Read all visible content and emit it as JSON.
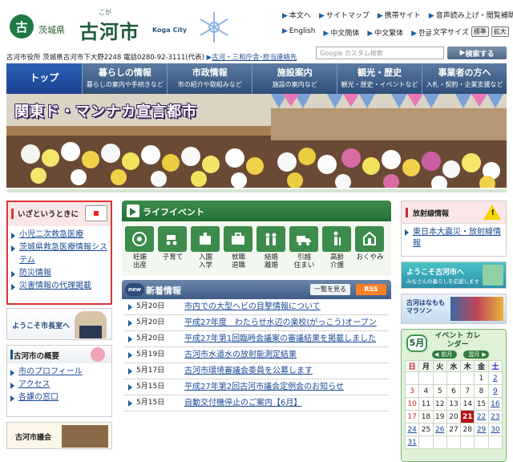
{
  "header": {
    "emblem": "古",
    "prefecture": "茨城県",
    "city_name": "古河市",
    "city_ruby": "こが",
    "city_en": "Koga City",
    "toplinks": [
      "本文へ",
      "サイトマップ",
      "携帯サイト",
      "音声読み上げ・閲覧補助"
    ],
    "languages": [
      "English",
      "中文簡体",
      "中文繁体",
      "한글"
    ],
    "fontsize_label": "文字サイズ",
    "fontsize_standard": "標準",
    "fontsize_large": "拡大",
    "address": "古河市役所 茨城県古河市下大野2248 電話0280-92-3111(代表)",
    "address_link": "古河・三和庁舎･担当連絡先",
    "search_placeholder": "Google カスタム検索",
    "search_button": "検索する"
  },
  "nav": [
    {
      "title": "トップ",
      "sub": ""
    },
    {
      "title": "暮らしの情報",
      "sub": "暮らしの案内や手続きなど"
    },
    {
      "title": "市政情報",
      "sub": "市の紹介や取組みなど"
    },
    {
      "title": "施設案内",
      "sub": "施設の案内など"
    },
    {
      "title": "観光・歴史",
      "sub": "観光・歴史・イベントなど"
    },
    {
      "title": "事業者の方へ",
      "sub": "入札・契約・企業支援など"
    }
  ],
  "banner": {
    "title": "関東ド・マンナカ宣言都市"
  },
  "emergency": {
    "title": "いざというときに",
    "links": [
      "小児二次救急医療",
      "茨城県救急医療情報システム",
      "防災情報",
      "災害情報の代理掲載"
    ]
  },
  "mayor": {
    "title": "ようこそ市長室へ"
  },
  "overview": {
    "title": "古河市の概要",
    "links": [
      "市のプロフィール",
      "アクセス",
      "各課の窓口"
    ]
  },
  "council": {
    "title": "古河市議会"
  },
  "life_event": {
    "title": "ライフイベント",
    "items": [
      {
        "label1": "妊娠",
        "label2": "出産"
      },
      {
        "label1": "子育て",
        "label2": ""
      },
      {
        "label1": "入園",
        "label2": "入学"
      },
      {
        "label1": "就職",
        "label2": "退職"
      },
      {
        "label1": "結婚",
        "label2": "離婚"
      },
      {
        "label1": "引越",
        "label2": "住まい"
      },
      {
        "label1": "高齢",
        "label2": "介護"
      },
      {
        "label1": "おくやみ",
        "label2": ""
      }
    ]
  },
  "news": {
    "badge": "new",
    "title": "新着情報",
    "list_button": "一覧を見る",
    "rss": "RSS",
    "items": [
      {
        "date": "5月20日",
        "title": "市内での大型ヘビの目撃情報について"
      },
      {
        "date": "5月20日",
        "title": "平成27年度　わたらせ水辺の楽校(がっこう)オープン"
      },
      {
        "date": "5月20日",
        "title": "平成27年第1回臨時会議案の審議結果を掲載しました"
      },
      {
        "date": "5月19日",
        "title": "古河市水道水の放射能測定結果"
      },
      {
        "date": "5月17日",
        "title": "古河市環境審議会委員を公募します"
      },
      {
        "date": "5月15日",
        "title": "平成27年第2回古河市議会定例会のお知らせ"
      },
      {
        "date": "5月15日",
        "title": "自動交付機停止のご案内【6月】"
      }
    ]
  },
  "disaster": {
    "title": "放射線情報",
    "warn": "!",
    "link": "東日本大震災・放射線情報"
  },
  "welcome": {
    "title": "ようこそ古河市へ",
    "sub": "みなさんの暮らしを応援します"
  },
  "marathon": {
    "title": "古河はなもも マラソン"
  },
  "calendar": {
    "month": "5月",
    "title": "イベント カレンダー",
    "prev": "前月",
    "next": "翌月",
    "weekdays": [
      "日",
      "月",
      "火",
      "水",
      "木",
      "金",
      "土"
    ],
    "weeks": [
      [
        "",
        "",
        "",
        "",
        "",
        "1",
        "2"
      ],
      [
        "3",
        "4",
        "5",
        "6",
        "7",
        "8",
        "9"
      ],
      [
        "10",
        "11",
        "12",
        "13",
        "14",
        "15",
        "16"
      ],
      [
        "17",
        "18",
        "19",
        "20",
        "21",
        "22",
        "23"
      ],
      [
        "24",
        "25",
        "26",
        "27",
        "28",
        "29",
        "30"
      ],
      [
        "31",
        "",
        "",
        "",
        "",
        "",
        ""
      ]
    ],
    "today": "21",
    "linked_days": [
      "2",
      "9",
      "16",
      "22",
      "23",
      "24",
      "26",
      "29",
      "30",
      "31"
    ]
  }
}
